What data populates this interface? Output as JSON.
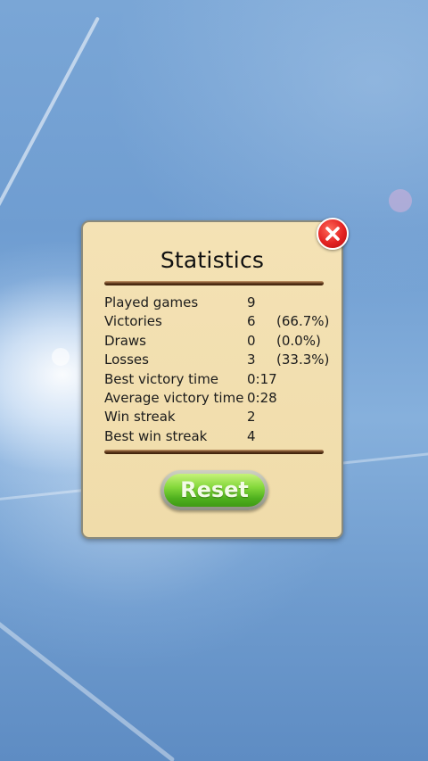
{
  "dialog": {
    "title": "Statistics",
    "close_icon": "close-icon",
    "reset_label": "Reset"
  },
  "stats": [
    {
      "label": "Played games",
      "value": "9",
      "pct": ""
    },
    {
      "label": "Victories",
      "value": "6",
      "pct": "(66.7%)"
    },
    {
      "label": "Draws",
      "value": "0",
      "pct": "(0.0%)"
    },
    {
      "label": "Losses",
      "value": "3",
      "pct": "(33.3%)"
    },
    {
      "label": "Best victory time",
      "value": "0:17",
      "pct": ""
    },
    {
      "label": "Average victory time",
      "value": "0:28",
      "pct": ""
    },
    {
      "label": "Win streak",
      "value": "2",
      "pct": ""
    },
    {
      "label": "Best win streak",
      "value": "4",
      "pct": ""
    }
  ],
  "colors": {
    "panel": "#f2dfaf",
    "close": "#e32222",
    "reset": "#86d93c",
    "divider": "#5a3518"
  }
}
